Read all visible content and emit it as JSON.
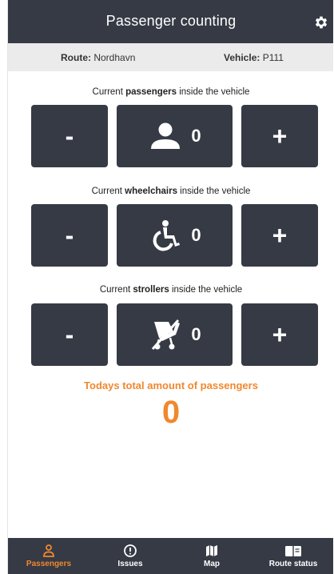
{
  "header": {
    "title": "Passenger counting",
    "settings_icon": "gear-icon"
  },
  "info": {
    "route_label": "Route:",
    "route_value": "Nordhavn",
    "vehicle_label": "Vehicle:",
    "vehicle_value": "P111"
  },
  "counters": [
    {
      "label_pre": "Current ",
      "label_bold": "passengers",
      "label_post": " inside the vehicle",
      "minus": "-",
      "plus": "+",
      "count": "0",
      "icon": "person-icon"
    },
    {
      "label_pre": "Current ",
      "label_bold": "wheelchairs",
      "label_post": " inside the vehicle",
      "minus": "-",
      "plus": "+",
      "count": "0",
      "icon": "wheelchair-icon"
    },
    {
      "label_pre": "Current ",
      "label_bold": "strollers",
      "label_post": " inside the vehicle",
      "minus": "-",
      "plus": "+",
      "count": "0",
      "icon": "stroller-icon"
    }
  ],
  "total": {
    "label": "Todays total amount of passengers",
    "value": "0"
  },
  "nav": {
    "items": [
      {
        "label": "Passengers",
        "icon": "person-outline-icon",
        "active": true
      },
      {
        "label": "Issues",
        "icon": "alert-circle-icon",
        "active": false
      },
      {
        "label": "Map",
        "icon": "map-icon",
        "active": false
      },
      {
        "label": "Route status",
        "icon": "book-icon",
        "active": false
      }
    ]
  },
  "colors": {
    "dark": "#363a45",
    "accent": "#f0882e",
    "infobar": "#ebebeb"
  }
}
